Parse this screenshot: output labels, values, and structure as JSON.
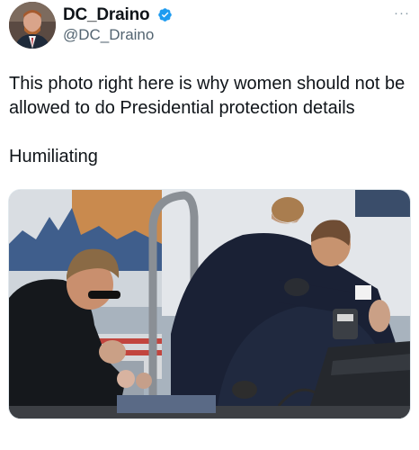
{
  "author": {
    "display_name": "DC_Draino",
    "handle": "@DC_Draino",
    "verified": true
  },
  "more_menu_label": "···",
  "tweet": {
    "text": "This photo right here is why women should not be allowed to do Presidential protection details",
    "text_2": "Humiliating"
  },
  "colors": {
    "verified_badge": "#1d9bf0",
    "handle": "#536471",
    "text": "#0f1419"
  },
  "icons": {
    "verified": "verified-badge-icon",
    "more": "more-options-icon"
  }
}
